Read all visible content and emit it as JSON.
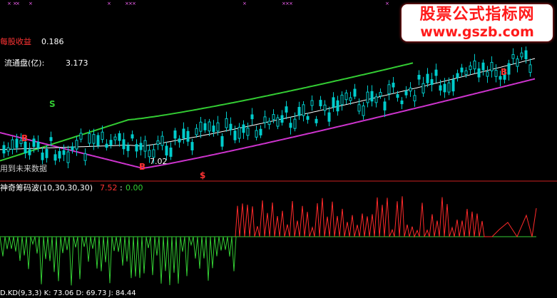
{
  "watermark": {
    "line1": "股票公式指标网",
    "line2": "www.gszb.com"
  },
  "info": {
    "eps_label": "每股收益",
    "eps_value": "0.186",
    "float_label": "流通盘(亿):",
    "float_value": "3.173",
    "future_note": "用到未来数据"
  },
  "markers": {
    "s_label": "S",
    "b_label_left": "B",
    "b_label_right": "B",
    "dollar_label": "$",
    "low_price": "7.02"
  },
  "indicator": {
    "title": "神奇筹码波(10,30,30,30)",
    "value_red": "7.52",
    "value_green": "0.00"
  },
  "bottom_bar": {
    "text": "D.KD(9,3,3)  K: 73.06  D: 69.73  J: 84.44"
  },
  "colors": {
    "background": "#000000",
    "upper_band": "#33cc33",
    "lower_band": "#cc33cc",
    "midline": "#ffffff",
    "candle_up": "#00cccc",
    "candle_up_fill": "#000000",
    "panel_divider": "#cc2222",
    "osc_up": "#ff2a2a",
    "osc_down": "#33cc33",
    "zero_line": "#33cc33",
    "label_red": "#ff3333",
    "label_green": "#33cc33",
    "label_white": "#ffffff"
  },
  "chart_data": {
    "type": "candlestick",
    "note_panel_top": "price chart with upper band (green), lower band (magenta), mid line (white)",
    "price_low_annotation": 7.02,
    "oscillator": {
      "name": "神奇筹码波",
      "last_values": [
        7.52,
        0.0
      ]
    }
  }
}
